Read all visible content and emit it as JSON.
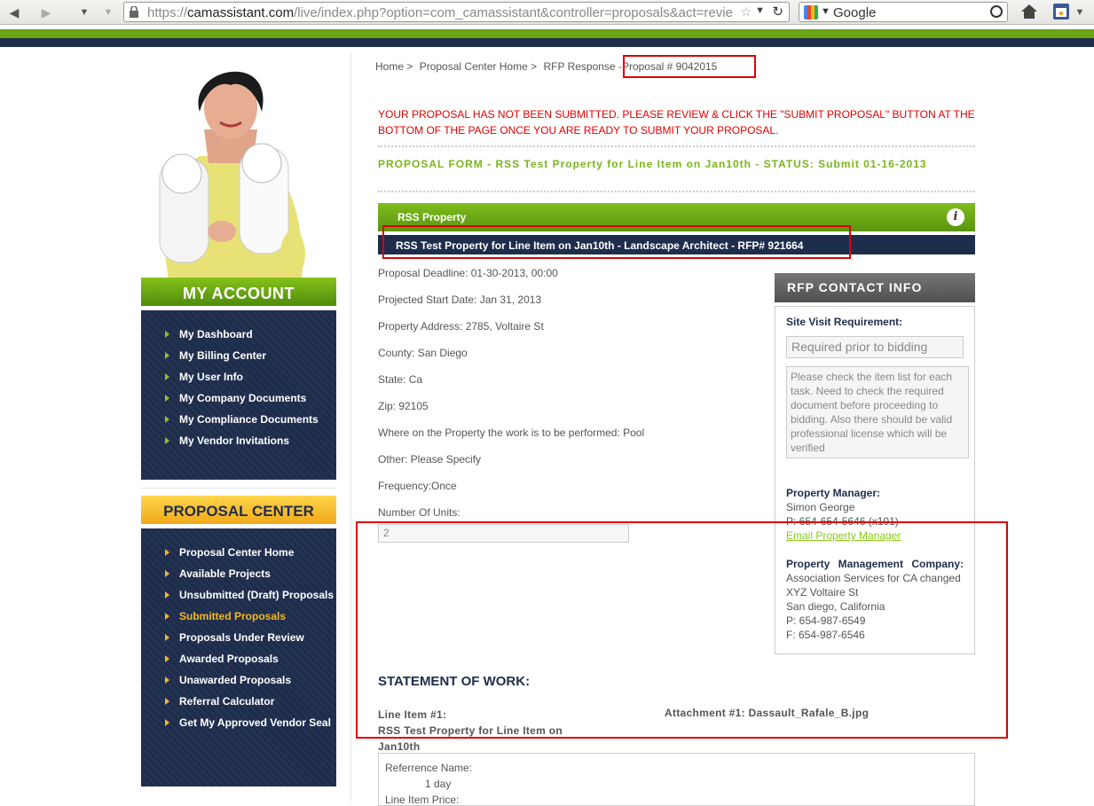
{
  "browser": {
    "url_scheme": "https://",
    "url_domain": "camassistant.com",
    "url_rest": "/live/index.php?option=com_camassistant&controller=proposals&act=revie",
    "search_engine": "Google"
  },
  "sidebar": {
    "account_title": "MY ACCOUNT",
    "account_items": [
      "My Dashboard",
      "My Billing Center",
      "My User Info",
      "My Company Documents",
      "My Compliance Documents",
      "My Vendor Invitations"
    ],
    "proposal_title": "PROPOSAL CENTER",
    "proposal_items": [
      "Proposal Center Home",
      "Available Projects",
      "Unsubmitted (Draft) Proposals",
      "Submitted Proposals",
      "Proposals Under Review",
      "Awarded Proposals",
      "Unawarded Proposals",
      "Referral Calculator",
      "Get My Approved Vendor Seal"
    ],
    "active_item": "Submitted Proposals"
  },
  "breadcrumb": {
    "home": "Home >",
    "center": "Proposal Center Home >",
    "response": "RFP Response -",
    "proposal": "Proposal # 9042015"
  },
  "warning": "YOUR PROPOSAL HAS NOT BEEN SUBMITTED. PLEASE REVIEW & CLICK THE \"SUBMIT PROPOSAL\" BUTTON AT THE BOTTOM OF THE PAGE ONCE YOU ARE READY TO SUBMIT YOUR PROPOSAL.",
  "form_title": "PROPOSAL FORM - RSS Test Property for Line Item on Jan10th - STATUS: Submit 01-16-2013",
  "property_bar": "RSS Property",
  "project_bar": "RSS Test Property for Line Item on Jan10th - Landscape Architect - RFP# 921664",
  "details": {
    "deadline": "Proposal Deadline: 01-30-2013, 00:00",
    "start": "Projected Start Date: Jan 31, 2013",
    "address": "Property Address: 2785, Voltaire St",
    "county": "County: San Diego",
    "state": "State: Ca",
    "zip": "Zip: 92105",
    "where": "Where on the Property the work is to be performed: Pool",
    "other": "Other: Please Specify",
    "frequency": "Frequency:Once",
    "units_label": "Number Of Units:",
    "units_value": "2"
  },
  "rfp_contact": {
    "title": "RFP CONTACT INFO",
    "site_visit_label": "Site Visit Requirement:",
    "site_visit_value": "Required prior to bidding",
    "note": "Please check the item list for each task. Need to check the required document before proceeding to bidding. Also there should be valid professional license which will be verified",
    "manager_label": "Property Manager:",
    "manager_name": "Simon George",
    "manager_phone": "P: 654-654-5646 (x101)",
    "email_link": "Email Property Manager",
    "company_label": "Property Management Company:",
    "company_name": "Association Services for CA changed",
    "company_street": "XYZ Voltaire St",
    "company_city": "San diego, California",
    "company_phone": "P: 654-987-6549",
    "company_fax": "F: 654-987-6546"
  },
  "statement": {
    "title": "STATEMENT OF WORK:",
    "line_item": "Line Item #1:",
    "line_item_name": "RSS Test Property for Line Item on Jan10th",
    "attachment": "Attachment #1: Dassault_Rafale_B.jpg",
    "ref_name_label": "Referrence Name:",
    "ref_name_value": "1 day",
    "line_price_label": "Line Item Price:"
  },
  "colors": {
    "green": "#6aa616",
    "navy": "#1f2d4d",
    "yellow": "#f4b81f",
    "warning": "#e00000"
  }
}
